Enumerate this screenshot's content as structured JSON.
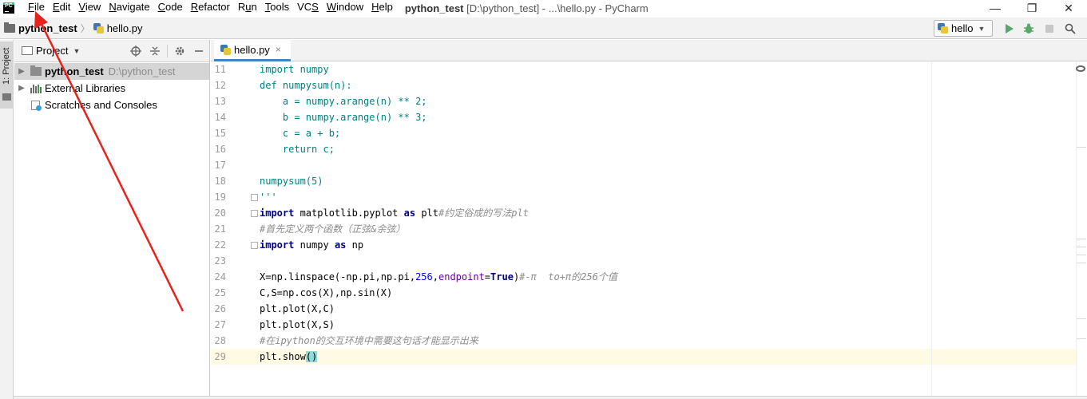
{
  "app": {
    "logo": "pycharm-logo",
    "title_project": "python_test",
    "title_rest": "[D:\\python_test] - ...\\hello.py - PyCharm"
  },
  "menu": [
    {
      "label": "File",
      "mnemonic": "F"
    },
    {
      "label": "Edit",
      "mnemonic": "E"
    },
    {
      "label": "View",
      "mnemonic": "V"
    },
    {
      "label": "Navigate",
      "mnemonic": "N"
    },
    {
      "label": "Code",
      "mnemonic": "C"
    },
    {
      "label": "Refactor",
      "mnemonic": "R"
    },
    {
      "label": "Run",
      "mnemonic": "u"
    },
    {
      "label": "Tools",
      "mnemonic": "T"
    },
    {
      "label": "VCS",
      "mnemonic": "S"
    },
    {
      "label": "Window",
      "mnemonic": "W"
    },
    {
      "label": "Help",
      "mnemonic": "H"
    }
  ],
  "window_controls": {
    "minimize": "—",
    "restore": "❐",
    "close": "✕"
  },
  "breadcrumb": {
    "project": "python_test",
    "file": "hello.py"
  },
  "toolbar": {
    "run_config": "hello",
    "icons": [
      "run-icon",
      "debug-icon",
      "stop-icon",
      "search-icon"
    ]
  },
  "side_tab": {
    "label": "1: Project"
  },
  "project_panel": {
    "title": "Project",
    "tools": [
      "locate-icon",
      "collapse-icon",
      "gear-icon",
      "minimize-icon"
    ],
    "tree": [
      {
        "name": "python_test",
        "path": "D:\\python_test",
        "type": "folder",
        "selected": true,
        "bold": true
      },
      {
        "name": "External Libraries",
        "path": "",
        "type": "library"
      },
      {
        "name": "Scratches and Consoles",
        "path": "",
        "type": "scratch"
      }
    ]
  },
  "editor": {
    "tab": {
      "label": "hello.py",
      "close": "×"
    },
    "current_line": 29,
    "lines": [
      {
        "n": "11",
        "tokens": [
          {
            "t": "import numpy",
            "c": "tq"
          }
        ]
      },
      {
        "n": "12",
        "tokens": [
          {
            "t": "def numpysum(n):",
            "c": "tq"
          }
        ]
      },
      {
        "n": "13",
        "tokens": [
          {
            "t": "    a = numpy.arange(n) ** 2;",
            "c": "tq"
          }
        ]
      },
      {
        "n": "14",
        "tokens": [
          {
            "t": "    b = numpy.arange(n) ** 3;",
            "c": "tq"
          }
        ]
      },
      {
        "n": "15",
        "tokens": [
          {
            "t": "    c = a + b;",
            "c": "tq"
          }
        ]
      },
      {
        "n": "16",
        "tokens": [
          {
            "t": "    return c;",
            "c": "tq"
          }
        ]
      },
      {
        "n": "17",
        "tokens": []
      },
      {
        "n": "18",
        "tokens": [
          {
            "t": "numpysum(5)",
            "c": "tq"
          }
        ]
      },
      {
        "n": "19",
        "tokens": [
          {
            "t": "'''",
            "c": "tq"
          }
        ]
      },
      {
        "n": "20",
        "tokens": [
          {
            "t": "import",
            "c": "kw"
          },
          {
            "t": " matplotlib.pyplot ",
            "c": "fn"
          },
          {
            "t": "as",
            "c": "kw"
          },
          {
            "t": " plt",
            "c": "fn"
          },
          {
            "t": "#约定俗成的写法plt",
            "c": "cm"
          }
        ]
      },
      {
        "n": "21",
        "tokens": [
          {
            "t": "#首先定义两个函数（正弦&余弦）",
            "c": "cm"
          }
        ]
      },
      {
        "n": "22",
        "tokens": [
          {
            "t": "import",
            "c": "kw"
          },
          {
            "t": " numpy ",
            "c": "fn"
          },
          {
            "t": "as",
            "c": "kw"
          },
          {
            "t": " np",
            "c": "fn"
          }
        ]
      },
      {
        "n": "23",
        "tokens": []
      },
      {
        "n": "24",
        "tokens": [
          {
            "t": "X=np.linspace(-np.pi,np.pi,",
            "c": "fn"
          },
          {
            "t": "256",
            "c": "num"
          },
          {
            "t": ",",
            "c": "fn"
          },
          {
            "t": "endpoint",
            "c": "param"
          },
          {
            "t": "=",
            "c": "fn"
          },
          {
            "t": "True",
            "c": "kw"
          },
          {
            "t": ")",
            "c": "fn"
          },
          {
            "t": "#-π  to+π的256个值",
            "c": "cm"
          }
        ]
      },
      {
        "n": "25",
        "tokens": [
          {
            "t": "C,S=np.cos(X),np.sin(X)",
            "c": "fn"
          }
        ]
      },
      {
        "n": "26",
        "tokens": [
          {
            "t": "plt.plot(X,C)",
            "c": "fn"
          }
        ]
      },
      {
        "n": "27",
        "tokens": [
          {
            "t": "plt.plot(X,S)",
            "c": "fn"
          }
        ]
      },
      {
        "n": "28",
        "tokens": [
          {
            "t": "#在ipython的交互环境中需要这句话才能显示出来",
            "c": "cm"
          }
        ]
      },
      {
        "n": "29",
        "tokens": [
          {
            "t": "plt.show",
            "c": "fn"
          },
          {
            "t": "()",
            "c": "paren-match"
          }
        ]
      }
    ],
    "fold_markers_at": [
      "19",
      "20",
      "22"
    ]
  },
  "colors": {
    "annotation_arrow": "#e8231c",
    "keyword": "#000080",
    "comment": "#8c8c8c",
    "number": "#0000ff",
    "current_line": "#fffae3",
    "selection_tab_underline": "#4083c9"
  }
}
